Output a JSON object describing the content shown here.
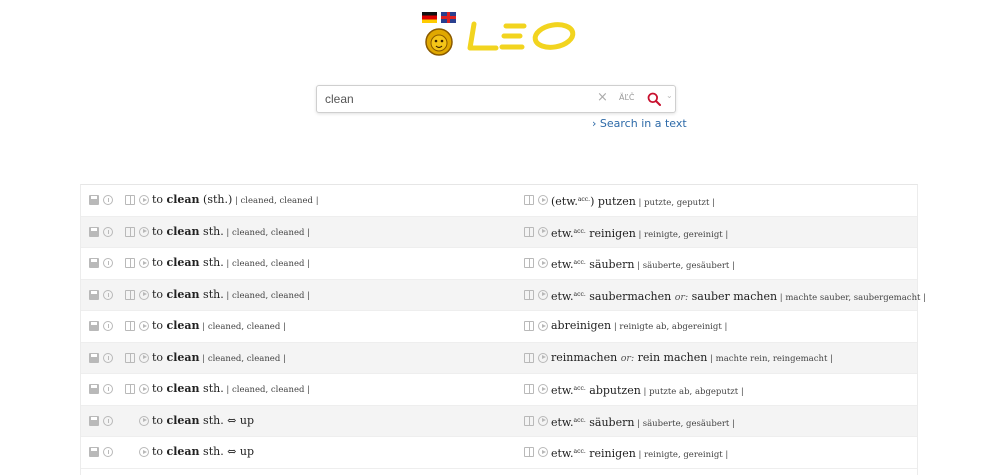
{
  "logo": {
    "text": "LEO"
  },
  "search": {
    "value": "clean",
    "spec_chars_label": "ÄĽČ",
    "search_text_link": "Search in a text"
  },
  "results": [
    {
      "bookmark": true,
      "left": [
        {
          "t": "n",
          "v": "to "
        },
        {
          "t": "b",
          "v": "clean"
        },
        {
          "t": "n",
          "v": " (sth.)"
        },
        {
          "t": "f",
          "v": "  | cleaned, cleaned |"
        }
      ],
      "right": [
        {
          "t": "n",
          "v": "(etw."
        },
        {
          "t": "s",
          "v": "acc."
        },
        {
          "t": "n",
          "v": ") putzen"
        },
        {
          "t": "f",
          "v": "  | putzte, geputzt |"
        }
      ]
    },
    {
      "bookmark": true,
      "left": [
        {
          "t": "n",
          "v": "to "
        },
        {
          "t": "b",
          "v": "clean"
        },
        {
          "t": "n",
          "v": " sth."
        },
        {
          "t": "f",
          "v": "  | cleaned, cleaned |"
        }
      ],
      "right": [
        {
          "t": "n",
          "v": "etw."
        },
        {
          "t": "s",
          "v": "acc."
        },
        {
          "t": "n",
          "v": " reinigen"
        },
        {
          "t": "f",
          "v": "  | reinigte, gereinigt |"
        }
      ]
    },
    {
      "bookmark": true,
      "left": [
        {
          "t": "n",
          "v": "to "
        },
        {
          "t": "b",
          "v": "clean"
        },
        {
          "t": "n",
          "v": " sth."
        },
        {
          "t": "f",
          "v": "  | cleaned, cleaned |"
        }
      ],
      "right": [
        {
          "t": "n",
          "v": "etw."
        },
        {
          "t": "s",
          "v": "acc."
        },
        {
          "t": "n",
          "v": " säubern"
        },
        {
          "t": "f",
          "v": "  | säuberte, gesäubert |"
        }
      ]
    },
    {
      "bookmark": true,
      "left": [
        {
          "t": "n",
          "v": "to "
        },
        {
          "t": "b",
          "v": "clean"
        },
        {
          "t": "n",
          "v": " sth."
        },
        {
          "t": "f",
          "v": "  | cleaned, cleaned |"
        }
      ],
      "right": [
        {
          "t": "n",
          "v": "etw."
        },
        {
          "t": "s",
          "v": "acc."
        },
        {
          "t": "n",
          "v": " saubermachen  "
        },
        {
          "t": "o",
          "v": "or:"
        },
        {
          "t": "n",
          "v": " sauber machen"
        },
        {
          "t": "f",
          "v": "  | machte sauber, saubergemacht |"
        }
      ]
    },
    {
      "bookmark": true,
      "left": [
        {
          "t": "n",
          "v": "to "
        },
        {
          "t": "b",
          "v": "clean"
        },
        {
          "t": "f",
          "v": "  | cleaned, cleaned |"
        }
      ],
      "right": [
        {
          "t": "n",
          "v": "abreinigen"
        },
        {
          "t": "f",
          "v": "  | reinigte ab, abgereinigt |"
        }
      ]
    },
    {
      "bookmark": true,
      "left": [
        {
          "t": "n",
          "v": "to "
        },
        {
          "t": "b",
          "v": "clean"
        },
        {
          "t": "f",
          "v": "  | cleaned, cleaned |"
        }
      ],
      "right": [
        {
          "t": "n",
          "v": "reinmachen  "
        },
        {
          "t": "o",
          "v": "or:"
        },
        {
          "t": "n",
          "v": " rein machen"
        },
        {
          "t": "f",
          "v": "  | machte rein, reingemacht |"
        }
      ]
    },
    {
      "bookmark": true,
      "left": [
        {
          "t": "n",
          "v": "to "
        },
        {
          "t": "b",
          "v": "clean"
        },
        {
          "t": "n",
          "v": " sth."
        },
        {
          "t": "f",
          "v": "  | cleaned, cleaned |"
        }
      ],
      "right": [
        {
          "t": "n",
          "v": "etw."
        },
        {
          "t": "s",
          "v": "acc."
        },
        {
          "t": "n",
          "v": " abputzen"
        },
        {
          "t": "f",
          "v": "  | putzte ab, abgeputzt |"
        }
      ]
    },
    {
      "bookmark": false,
      "left": [
        {
          "t": "n",
          "v": "to "
        },
        {
          "t": "b",
          "v": "clean"
        },
        {
          "t": "n",
          "v": " sth. ⇔ up"
        }
      ],
      "right": [
        {
          "t": "n",
          "v": "etw."
        },
        {
          "t": "s",
          "v": "acc."
        },
        {
          "t": "n",
          "v": " säubern"
        },
        {
          "t": "f",
          "v": "  | säuberte, gesäubert |"
        }
      ]
    },
    {
      "bookmark": false,
      "left": [
        {
          "t": "n",
          "v": "to "
        },
        {
          "t": "b",
          "v": "clean"
        },
        {
          "t": "n",
          "v": " sth. ⇔ up"
        }
      ],
      "right": [
        {
          "t": "n",
          "v": "etw."
        },
        {
          "t": "s",
          "v": "acc."
        },
        {
          "t": "n",
          "v": " reinigen"
        },
        {
          "t": "f",
          "v": "  | reinigte, gereinigt |"
        }
      ]
    }
  ],
  "icons": {
    "save": "save-icon",
    "info": "info-icon",
    "book": "book-icon",
    "play": "audio-play-icon",
    "search": "search-icon",
    "clear": "clear-icon",
    "dropdown": "chevron-down-icon",
    "link": "chevron-right-icon"
  },
  "colors": {
    "logo_yellow": "#f2d41f",
    "link_blue": "#2d6aa8",
    "search_red": "#c8102e",
    "row_alt": "#f4f4f4"
  }
}
